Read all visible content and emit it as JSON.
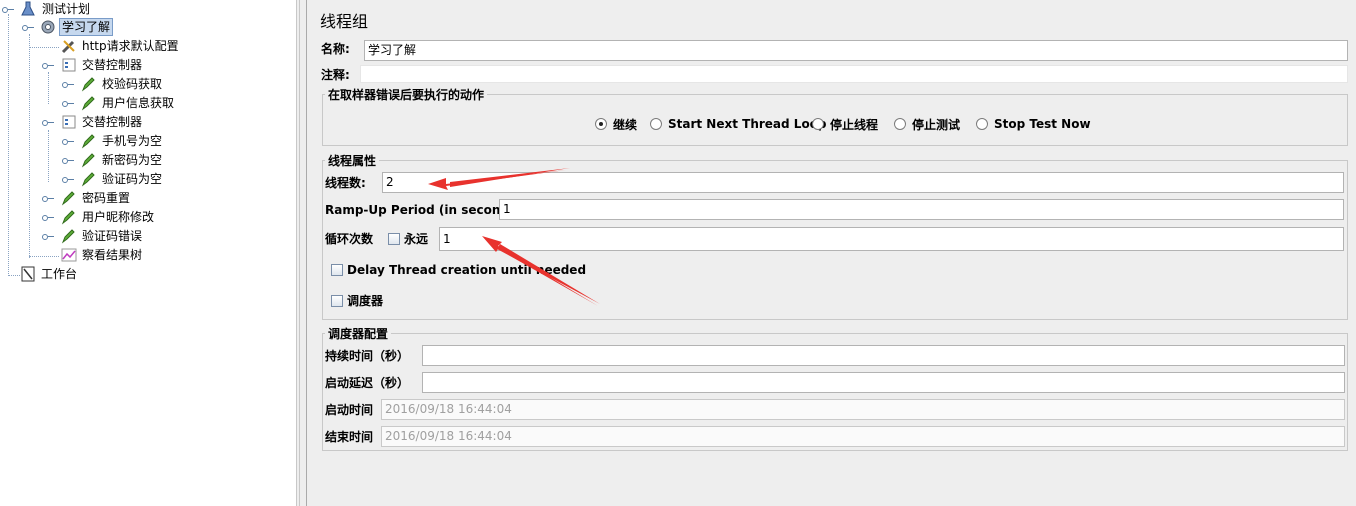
{
  "tree": {
    "nodes": [
      {
        "label": "测试计划",
        "icon": "flask-icon"
      },
      {
        "label": "学习了解",
        "icon": "gear-icon"
      },
      {
        "label": "http请求默认配置",
        "icon": "wrench-icon"
      },
      {
        "label": "交替控制器",
        "icon": "controller-icon"
      },
      {
        "label": "校验码获取",
        "icon": "sampler-pen-icon"
      },
      {
        "label": "用户信息获取",
        "icon": "sampler-pen-icon"
      },
      {
        "label": "交替控制器",
        "icon": "controller-icon"
      },
      {
        "label": "手机号为空",
        "icon": "sampler-pen-icon"
      },
      {
        "label": "新密码为空",
        "icon": "sampler-pen-icon"
      },
      {
        "label": "验证码为空",
        "icon": "sampler-pen-icon"
      },
      {
        "label": "密码重置",
        "icon": "sampler-pen-icon"
      },
      {
        "label": "用户昵称修改",
        "icon": "sampler-pen-icon"
      },
      {
        "label": "验证码错误",
        "icon": "sampler-pen-icon"
      },
      {
        "label": "察看结果树",
        "icon": "graph-icon"
      },
      {
        "label": "工作台",
        "icon": "workbench-icon"
      }
    ]
  },
  "panel": {
    "title": "线程组",
    "name_label": "名称:",
    "name_value": "学习了解",
    "comment_label": "注释:",
    "comment_value": "",
    "error_group": {
      "title": "在取样器错误后要执行的动作",
      "options": [
        "继续",
        "Start Next Thread Loop",
        "停止线程",
        "停止测试",
        "Stop Test Now"
      ],
      "selected": "继续"
    },
    "thread_group": {
      "title": "线程属性",
      "threads_label": "线程数:",
      "threads_value": "2",
      "rampup_label": "Ramp-Up Period (in seconds):",
      "rampup_value": "1",
      "loop_label": "循环次数",
      "forever_label": "永远",
      "loop_value": "1",
      "delay_label": "Delay Thread creation until needed",
      "scheduler_label": "调度器"
    },
    "scheduler_group": {
      "title": "调度器配置",
      "duration_label": "持续时间（秒）",
      "duration_value": "",
      "startup_delay_label": "启动延迟（秒）",
      "startup_delay_value": "",
      "start_time_label": "启动时间",
      "start_time_value": "2016/09/18 16:44:04",
      "end_time_label": "结束时间",
      "end_time_value": "2016/09/18 16:44:04"
    }
  },
  "colors": {
    "panel_bg": "#eeeeee",
    "selection_bg": "#c6d8ee",
    "annotation_arrow": "#e8322d"
  }
}
